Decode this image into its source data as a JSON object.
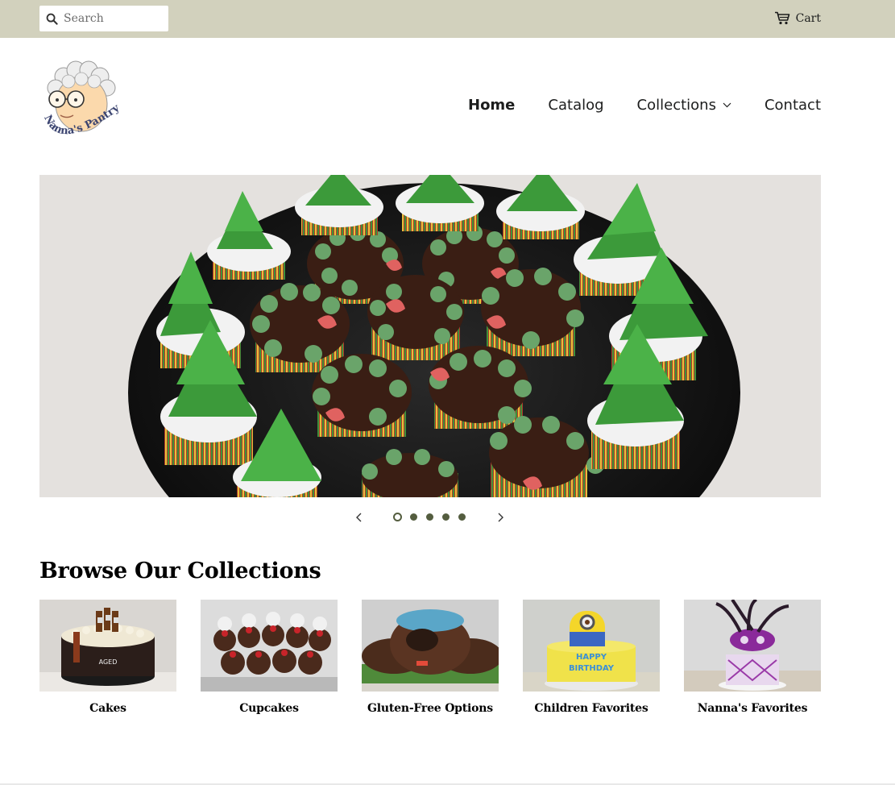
{
  "topbar": {
    "search_placeholder": "Search",
    "cart_label": "Cart"
  },
  "brand": {
    "logo_text": "Nanna's Pantry"
  },
  "nav": {
    "items": [
      {
        "label": "Home",
        "active": true
      },
      {
        "label": "Catalog",
        "active": false
      },
      {
        "label": "Collections",
        "active": false,
        "has_dropdown": true
      },
      {
        "label": "Contact",
        "active": false
      }
    ]
  },
  "slideshow": {
    "current_slide": 1,
    "total_slides": 5
  },
  "collections": {
    "title": "Browse Our Collections",
    "items": [
      {
        "label": "Cakes"
      },
      {
        "label": "Cupcakes"
      },
      {
        "label": "Gluten-Free Options"
      },
      {
        "label": "Children Favorites"
      },
      {
        "label": "Nanna's Favorites"
      }
    ]
  },
  "colors": {
    "topbar_bg": "#d2d1bd",
    "accent": "#545d3f",
    "text": "#1c1d1d"
  },
  "icons": [
    "search-icon",
    "cart-icon",
    "chevron-down-icon",
    "chevron-left-icon",
    "chevron-right-icon"
  ]
}
